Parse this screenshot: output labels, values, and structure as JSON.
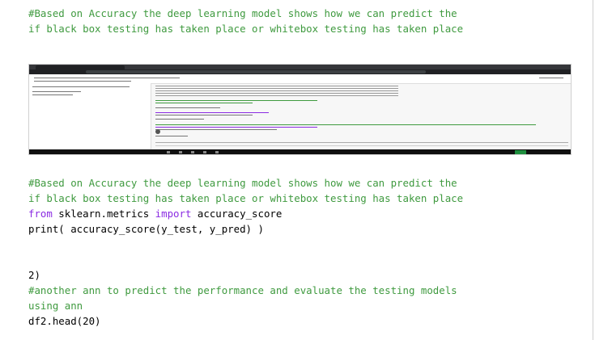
{
  "block1": {
    "line1": "#Based on Accuracy the deep learning model shows how we can predict the",
    "line2": "if black box testing has taken place or whitebox testing has taken place"
  },
  "embedded_screenshot": {
    "description_icon": "embedded-screenshot-image"
  },
  "block2": {
    "line1": "#Based on Accuracy the deep learning model shows how we can predict the",
    "line2": "if black box testing has taken place or whitebox testing has taken place",
    "line3_kw_from": "from",
    "line3_module": " sklearn.metrics ",
    "line3_kw_import": "import",
    "line3_name": " accuracy_score",
    "line4": "print( accuracy_score(y_test, y_pred) )"
  },
  "block3": {
    "line1": "2)",
    "line2": "#another ann to predict the performance and evaluate the testing models",
    "line3": "using ann",
    "line4": "df2.head(20)"
  },
  "colors": {
    "comment": "#3f9a3f",
    "keyword": "#8a2be2",
    "text": "#000000"
  }
}
